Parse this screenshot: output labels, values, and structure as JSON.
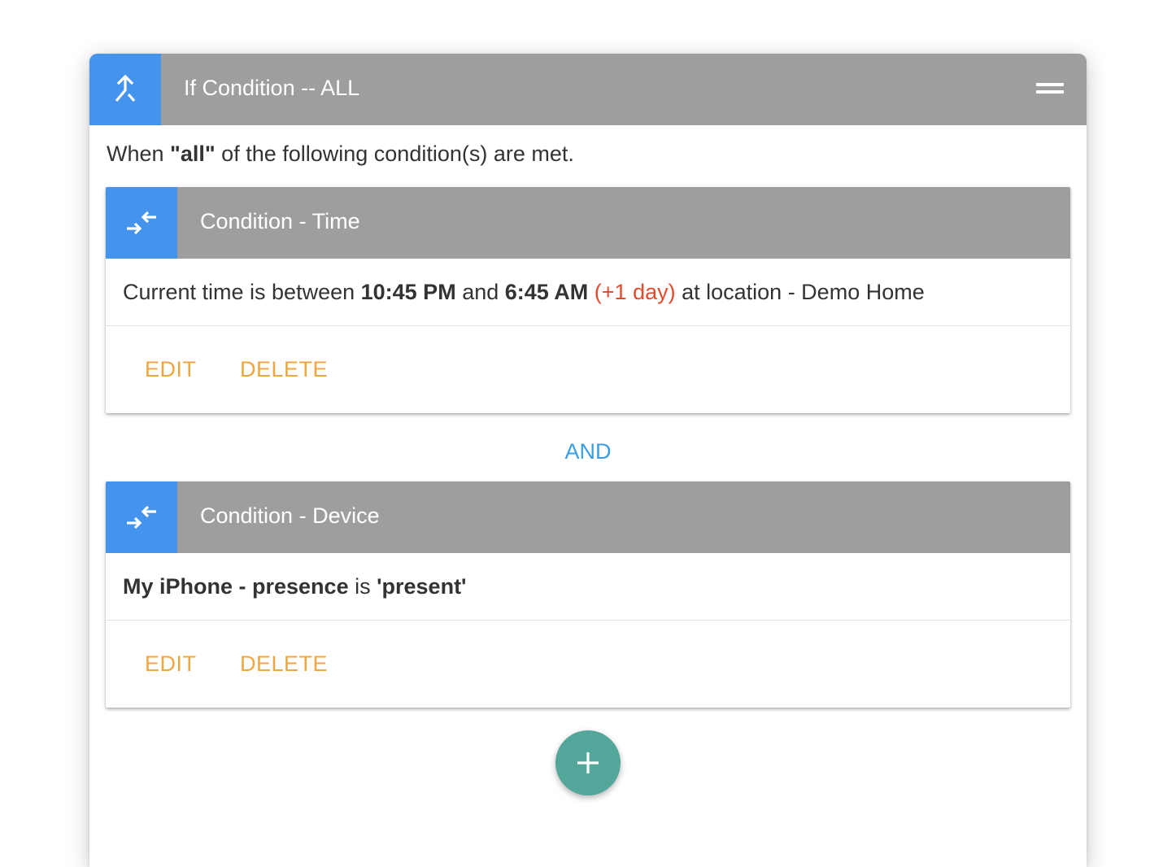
{
  "panel": {
    "title": "If Condition -- ALL",
    "icon": "merge-icon",
    "menu_icon": "drag-handle-icon",
    "description_prefix": "When ",
    "description_emphasis": "\"all\"",
    "description_suffix": " of the following condition(s) are met."
  },
  "conditions": [
    {
      "title": "Condition - Time",
      "icon": "compare-arrows-icon",
      "body": {
        "p1": "Current time is between ",
        "start_time": "10:45 PM",
        "p2": " and ",
        "end_time": "6:45 AM",
        "p3": " ",
        "day_offset": "(+1 day)",
        "p4": " at location - Demo Home"
      },
      "edit_label": "EDIT",
      "delete_label": "DELETE"
    },
    {
      "title": "Condition - Device",
      "icon": "compare-arrows-icon",
      "body": {
        "device": "My iPhone - presence",
        "p1": " is ",
        "value": "'present'"
      },
      "edit_label": "EDIT",
      "delete_label": "DELETE"
    }
  ],
  "operator_label": "AND",
  "add_button": {
    "icon": "plus-icon"
  },
  "colors": {
    "header_gray": "#9e9e9e",
    "icon_blue": "#4493ed",
    "action_orange": "#f0a640",
    "operator_blue": "#3d9de4",
    "highlight_red": "#e04b2f",
    "fab_teal": "#52a69a"
  }
}
